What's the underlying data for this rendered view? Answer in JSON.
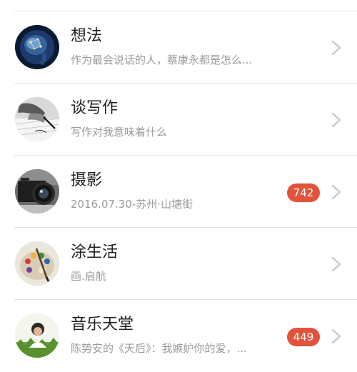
{
  "list": {
    "items": [
      {
        "title": "想法",
        "subtitle": "作为最会说话的人，蔡康永都是怎么...",
        "badge": null,
        "avatar_icon": "brain-network-avatar"
      },
      {
        "title": "谈写作",
        "subtitle": "写作对我意味着什么",
        "badge": null,
        "avatar_icon": "hand-writing-avatar"
      },
      {
        "title": "摄影",
        "subtitle": "2016.07.30-苏州·山塘街",
        "badge": "742",
        "avatar_icon": "camera-avatar"
      },
      {
        "title": "涂生活",
        "subtitle": "画.启航",
        "badge": null,
        "avatar_icon": "paint-palette-avatar"
      },
      {
        "title": "音乐天堂",
        "subtitle": "陈势安的《天后》：我嫉妒你的爱，...",
        "badge": "449",
        "avatar_icon": "person-grass-avatar"
      }
    ]
  },
  "colors": {
    "badge": "#e2533b",
    "title": "#222222",
    "subtitle": "#9a9a9a",
    "divider": "#e2e2e2",
    "chevron": "#c7c7cc"
  }
}
